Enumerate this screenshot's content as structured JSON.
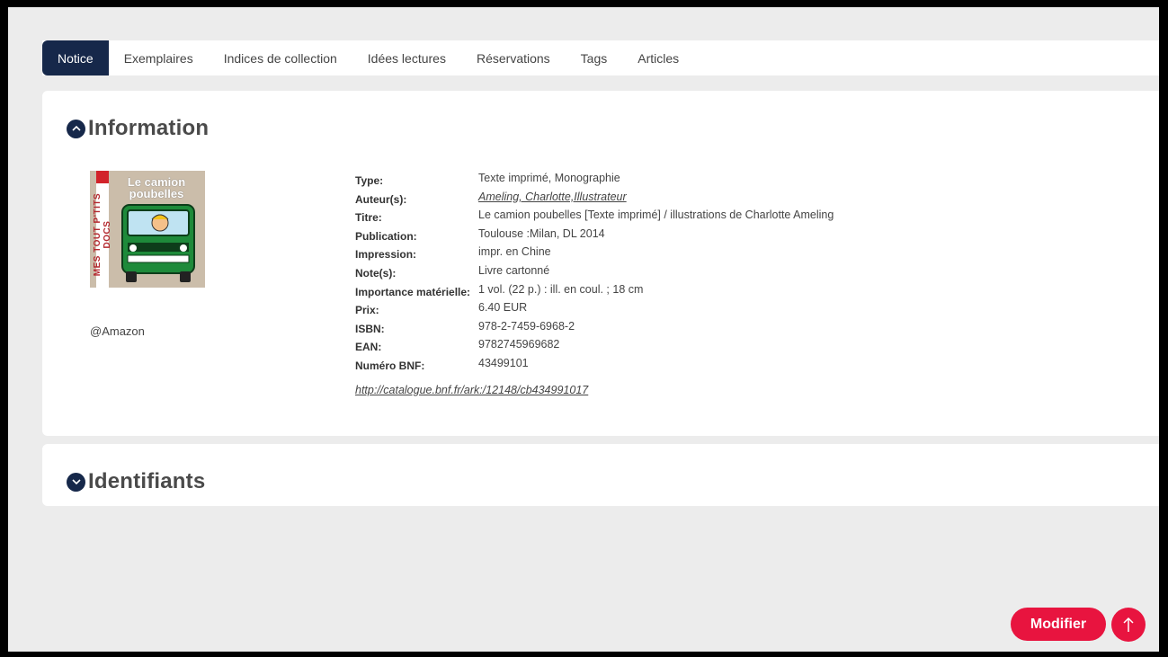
{
  "tabs": [
    {
      "label": "Notice",
      "active": true
    },
    {
      "label": "Exemplaires"
    },
    {
      "label": "Indices de collection"
    },
    {
      "label": "Idées lectures"
    },
    {
      "label": "Réservations"
    },
    {
      "label": "Tags"
    },
    {
      "label": "Articles"
    }
  ],
  "information": {
    "title": "Information",
    "toggle_icon": "chevron-up-icon",
    "cover": {
      "title_line1": "Le camion",
      "title_line2": "poubelles",
      "series": "MES TOUT P'TITS DOCS",
      "credit": "@Amazon"
    },
    "fields": [
      {
        "label": "Type:",
        "value": "Texte imprimé, Monographie"
      },
      {
        "label": "Auteur(s):",
        "value": "Ameling, Charlotte,Illustrateur",
        "link": true
      },
      {
        "label": "Titre:",
        "value": "Le camion poubelles [Texte imprimé] / illustrations de Charlotte Ameling"
      },
      {
        "label": "Publication:",
        "value": "Toulouse :Milan, DL 2014"
      },
      {
        "label": "Impression:",
        "value": "impr. en Chine"
      },
      {
        "label": "Note(s):",
        "value": "Livre cartonné"
      },
      {
        "label": "Importance matérielle:",
        "value": "1 vol. (22 p.) : ill. en coul. ; 18 cm"
      },
      {
        "label": "Prix:",
        "value": "6.40 EUR"
      },
      {
        "label": "ISBN:",
        "value": "978-2-7459-6968-2"
      },
      {
        "label": "EAN:",
        "value": "9782745969682"
      },
      {
        "label": "Numéro BNF:",
        "value": "43499101"
      }
    ],
    "permalink": "http://catalogue.bnf.fr/ark:/12148/cb434991017"
  },
  "identifiants": {
    "title": "Identifiants",
    "toggle_icon": "chevron-down-icon"
  },
  "actions": {
    "modifier_label": "Modifier",
    "top_icon": "arrow-up-icon"
  },
  "colors": {
    "navy": "#16284a",
    "accent": "#e8143f",
    "background": "#ececec"
  }
}
